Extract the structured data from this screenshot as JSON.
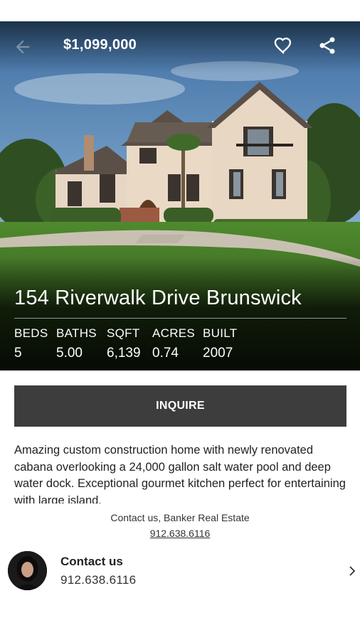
{
  "header": {
    "price": "$1,099,000",
    "icons": [
      "back-arrow-icon",
      "heart-icon",
      "share-icon"
    ]
  },
  "listing": {
    "address": "154 Riverwalk Drive Brunswick",
    "stats": [
      {
        "label": "BEDS",
        "value": "5"
      },
      {
        "label": "BATHS",
        "value": "5.00"
      },
      {
        "label": "SQFT",
        "value": "6,139"
      },
      {
        "label": "ACRES",
        "value": "0.74"
      },
      {
        "label": "BUILT",
        "value": "2007"
      }
    ],
    "inquire_label": "INQUIRE",
    "description": "Amazing custom construction home with newly renovated cabana overlooking a 24,000 gallon salt water pool and deep water dock. Exceptional gourmet kitchen perfect for entertaining with large island."
  },
  "contact": {
    "credit_line": "Contact us, Banker Real Estate",
    "credit_phone": "912.638.6116",
    "title": "Contact us",
    "phone": "912.638.6116"
  },
  "colors": {
    "inquire_bg": "#3d3d3d",
    "text": "#222222",
    "white": "#ffffff"
  }
}
